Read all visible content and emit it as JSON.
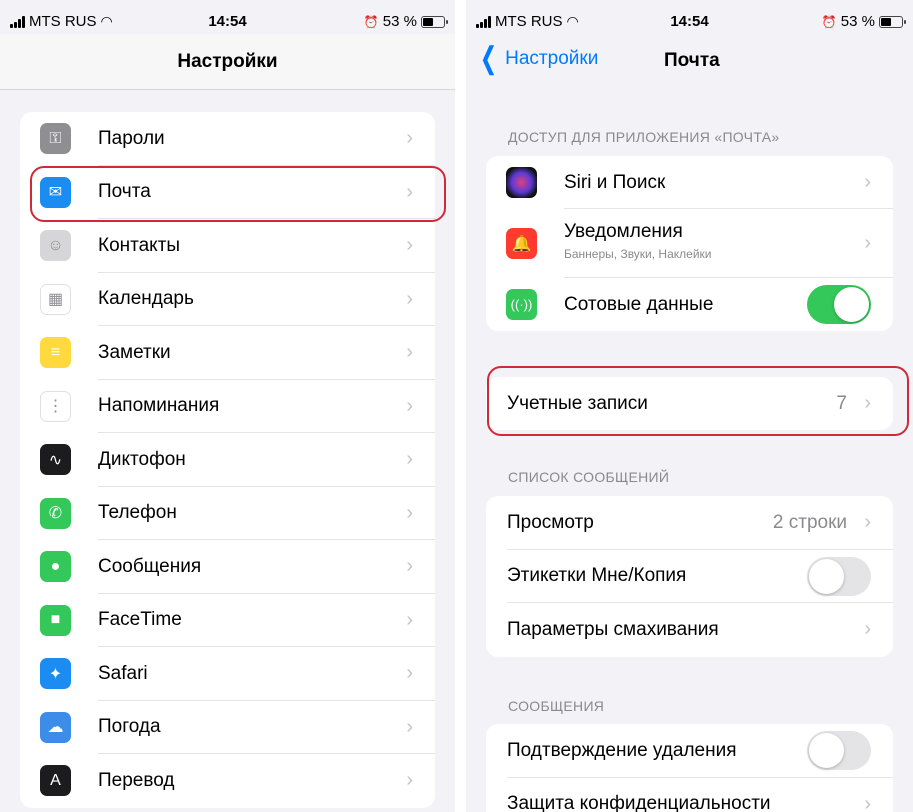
{
  "left": {
    "status": {
      "carrier": "MTS RUS",
      "time": "14:54",
      "battery": "53 %"
    },
    "nav_title": "Настройки",
    "items": [
      {
        "label": "Пароли",
        "icon": "key-icon",
        "color": "#8e8e93",
        "glyph": "⚿"
      },
      {
        "label": "Почта",
        "icon": "mail-icon",
        "color": "#1a8cf2",
        "glyph": "✉"
      },
      {
        "label": "Контакты",
        "icon": "contacts-icon",
        "color": "#d6d6d9",
        "glyph": "☺"
      },
      {
        "label": "Календарь",
        "icon": "calendar-icon",
        "color": "#ffffff",
        "glyph": "▦"
      },
      {
        "label": "Заметки",
        "icon": "notes-icon",
        "color": "#ffd93d",
        "glyph": "≡"
      },
      {
        "label": "Напоминания",
        "icon": "reminders-icon",
        "color": "#ffffff",
        "glyph": "⋮"
      },
      {
        "label": "Диктофон",
        "icon": "voice-memo-icon",
        "color": "#1c1c1e",
        "glyph": "∿"
      },
      {
        "label": "Телефон",
        "icon": "phone-icon",
        "color": "#34c759",
        "glyph": "✆"
      },
      {
        "label": "Сообщения",
        "icon": "messages-icon",
        "color": "#34c759",
        "glyph": "●"
      },
      {
        "label": "FaceTime",
        "icon": "facetime-icon",
        "color": "#34c759",
        "glyph": "■"
      },
      {
        "label": "Safari",
        "icon": "safari-icon",
        "color": "#1a8cf2",
        "glyph": "✦"
      },
      {
        "label": "Погода",
        "icon": "weather-icon",
        "color": "#3b8de8",
        "glyph": "☁"
      },
      {
        "label": "Перевод",
        "icon": "translate-icon",
        "color": "#1c1c1e",
        "glyph": "A"
      }
    ]
  },
  "right": {
    "status": {
      "carrier": "MTS RUS",
      "time": "14:54",
      "battery": "53 %"
    },
    "back_label": "Настройки",
    "nav_title": "Почта",
    "section_access": "ДОСТУП ДЛЯ ПРИЛОЖЕНИЯ «ПОЧТА»",
    "access_items": {
      "siri": "Siri и Поиск",
      "notifications": "Уведомления",
      "notifications_sub": "Баннеры, Звуки, Наклейки",
      "cellular": "Сотовые данные"
    },
    "accounts": {
      "label": "Учетные записи",
      "value": "7"
    },
    "section_list": "СПИСОК СООБЩЕНИЙ",
    "list_items": {
      "preview": "Просмотр",
      "preview_value": "2 строки",
      "labels": "Этикетки Мне/Копия",
      "swipe": "Параметры смахивания"
    },
    "section_messages": "СООБЩЕНИЯ",
    "message_items": {
      "confirm_delete": "Подтверждение удаления",
      "privacy": "Защита конфиденциальности"
    },
    "toggles": {
      "cellular": true,
      "labels": false,
      "confirm_delete": false
    }
  },
  "chevron": "›",
  "colors": {
    "accent": "#007aff",
    "highlight": "#d0293a",
    "toggle_on": "#34c759"
  }
}
